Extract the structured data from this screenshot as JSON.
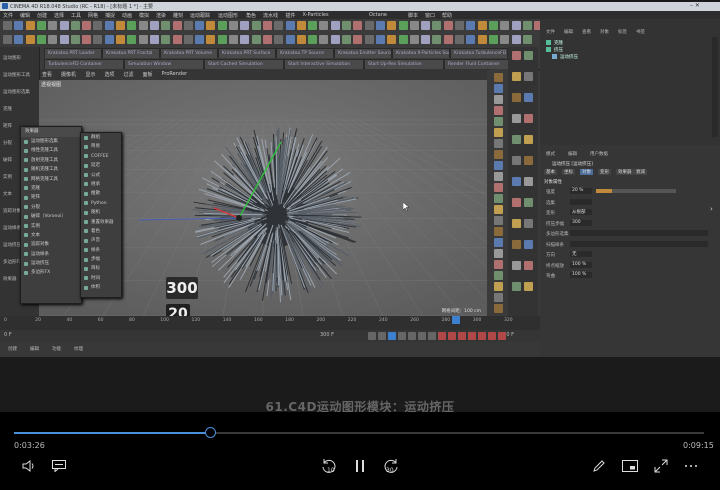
{
  "app": {
    "title_bar": "CINEMA 4D R18.048 Studio (RC - R18) - [未标题 1 *] - 主要",
    "menus": [
      "文件",
      "编辑",
      "创建",
      "选择",
      "工具",
      "网格",
      "捕捉",
      "动画",
      "模拟",
      "渲染",
      "雕刻",
      "运动跟踪",
      "运动图形",
      "角色",
      "流水线",
      "插件",
      "X-Particles",
      "Octane",
      "脚本",
      "窗口",
      "帮助"
    ],
    "plugin_tabs": [
      "Krakatoa PRT Loader",
      "Krakatoa PRT Fractal",
      "Krakatoa PRT Volume",
      "Krakatoa PRT Surface",
      "Krakatoa TP Source",
      "Krakatoa Emitter Source",
      "Krakatoa X-Particles Source",
      "Krakatoa TurbulenceFD Source"
    ],
    "plugin_tabs2": [
      "TurbulenceFD Container",
      "Simulation Window",
      "Start Cached Simulation",
      "Start Interactive Simulation",
      "Start Up-Res Simulation",
      "Render Fluid Container"
    ],
    "viewport_menu": [
      "查看",
      "摄像机",
      "显示",
      "选项",
      "过滤",
      "面板",
      "ProRender"
    ],
    "viewport_label": "透视视图",
    "grid_spacing": "网格间距：100 cm",
    "left_panel_items": [
      "运动图形",
      "运动图形工具",
      "运动图形选集",
      "克隆",
      "矩阵",
      "分裂",
      "破碎",
      "实例",
      "文本",
      "追踪对象",
      "运动样条",
      "运动挤压",
      "多边形FX",
      "效果器"
    ],
    "menu1": {
      "header": "效果器",
      "items": [
        "运动图形选集",
        "线性克隆工具",
        "放射克隆工具",
        "随机克隆工具",
        "网格克隆工具",
        "克隆",
        "矩阵",
        "分裂",
        "破碎（Voronoi）",
        "实例",
        "文本",
        "追踪对象",
        "运动样条",
        "运动挤压",
        "多边形FX"
      ]
    },
    "menu2": {
      "items": [
        "群组",
        "简易",
        "COFFEE",
        "延迟",
        "公式",
        "继承",
        "推散",
        "Python",
        "随机",
        "重置效果器",
        "着色",
        "声音",
        "样条",
        "步幅",
        "目标",
        "时间",
        "体积"
      ]
    },
    "overlay_numbers": [
      "300",
      "20"
    ],
    "timeline": {
      "ticks": [
        "0",
        "20",
        "40",
        "60",
        "80",
        "100",
        "120",
        "140",
        "160",
        "180",
        "200",
        "220",
        "240",
        "260",
        "280",
        "300",
        "320"
      ],
      "current_frame": "0 F",
      "end_frame": "300 F",
      "frame_readout": "300 F"
    },
    "material_manager": {
      "menus": [
        "创建",
        "编辑",
        "功能",
        "纹理"
      ]
    },
    "object_manager": {
      "menus": [
        "文件",
        "编辑",
        "查看",
        "对象",
        "标签",
        "书签"
      ],
      "objects": [
        "克隆",
        "挤压",
        "运动挤压"
      ]
    },
    "attribute_manager": {
      "menus": [
        "模式",
        "编辑",
        "用户数据"
      ],
      "title": "运动挤压 [运动挤压]",
      "tabs": [
        "基本",
        "坐标",
        "对象",
        "变形",
        "效果器",
        "衰减"
      ],
      "section": "对象属性",
      "fields": [
        {
          "label": "强度",
          "value": "20 %"
        },
        {
          "label": "选集",
          "value": ""
        },
        {
          "label": "变形",
          "value": "从根部"
        },
        {
          "label": "挤压步幅",
          "value": "300"
        },
        {
          "label": "多边形选集",
          "value": ""
        },
        {
          "label": "扫描样条",
          "value": ""
        },
        {
          "label": "方向",
          "value": "无"
        },
        {
          "label": "终点缩放",
          "value": "100 %"
        },
        {
          "label": "弯曲",
          "value": "100 %"
        }
      ]
    }
  },
  "video_subtitle": "61.C4D运动图形模块：运动挤压",
  "player": {
    "current_time": "0:03:26",
    "total_time": "0:09:15",
    "progress": 0.2839,
    "skip_back_label": "10",
    "skip_forward_label": "30",
    "accent_color": "#4a90d9"
  },
  "icons": {
    "volume": "volume-icon",
    "captions": "captions-icon",
    "skip_back": "skip-back-10-icon",
    "pause": "pause-icon",
    "skip_forward": "skip-forward-30-icon",
    "edit": "pen-icon",
    "mini_view": "mini-view-icon",
    "fullscreen": "fullscreen-icon",
    "more": "more-icon"
  }
}
